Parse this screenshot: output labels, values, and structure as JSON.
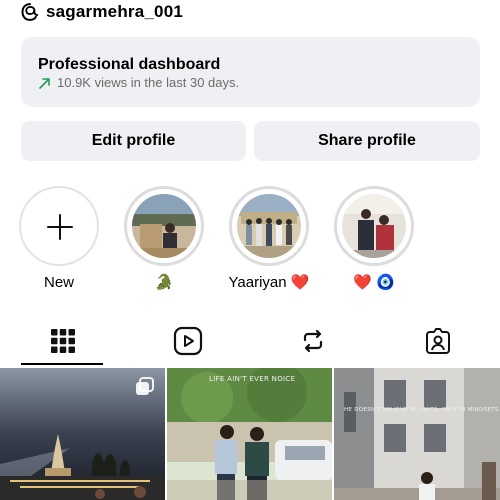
{
  "profile": {
    "username": "sagarmehra_001"
  },
  "dashboard": {
    "title": "Professional dashboard",
    "stats": "10.9K views in the last 30 days.",
    "accent_color": "#1f9e57"
  },
  "actions": {
    "edit_label": "Edit profile",
    "share_label": "Share profile"
  },
  "highlights": [
    {
      "label": "New",
      "icon": "plus-icon"
    },
    {
      "label": "🐊"
    },
    {
      "label": "Yaariyan ❤️"
    },
    {
      "label": "❤️ 🧿"
    }
  ],
  "tabs": [
    {
      "name": "grid",
      "icon": "grid-icon",
      "active": true
    },
    {
      "name": "reels",
      "icon": "reels-icon",
      "active": false
    },
    {
      "name": "reposts",
      "icon": "repost-icon",
      "active": false
    },
    {
      "name": "tagged",
      "icon": "tagged-icon",
      "active": false
    }
  ],
  "posts": [
    {
      "caption": ""
    },
    {
      "caption": "LIFE AIN'T EVER NOICE"
    },
    {
      "caption": "HE DOESN'T BELIEVE IN LIMITS, ONLY IN MINDSETS"
    }
  ]
}
